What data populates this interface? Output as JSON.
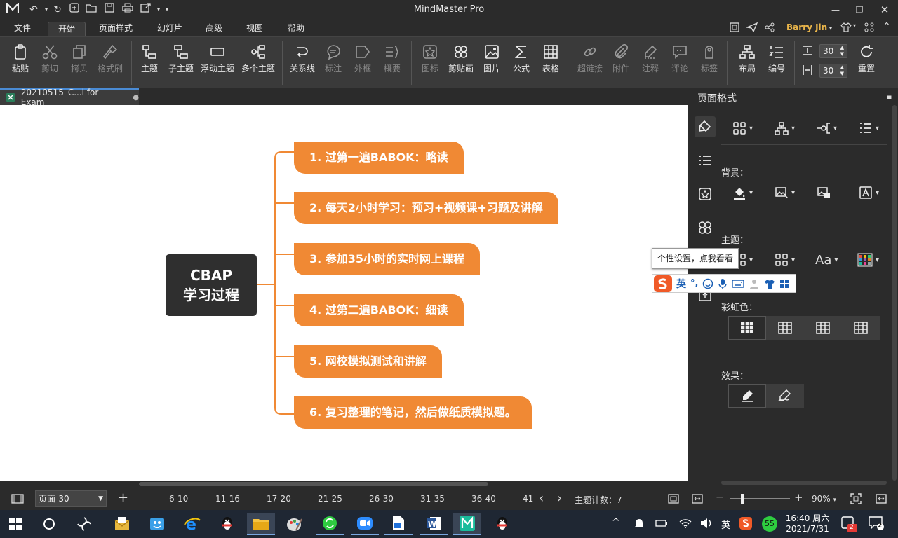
{
  "app": {
    "title": "MindMaster Pro",
    "user": "Barry Jin"
  },
  "menu": [
    "文件",
    "开始",
    "页面样式",
    "幻灯片",
    "高级",
    "视图",
    "帮助"
  ],
  "ribbon": {
    "paste": "粘贴",
    "cut": "剪切",
    "copy": "拷贝",
    "format_painter": "格式刷",
    "topic": "主题",
    "subtopic": "子主题",
    "floating_topic": "浮动主题",
    "multiple_topics": "多个主题",
    "relationship": "关系线",
    "callout": "标注",
    "boundary": "外框",
    "summary": "概要",
    "icon": "图标",
    "clipart": "剪贴画",
    "image": "图片",
    "formula": "公式",
    "table": "表格",
    "hyperlink": "超链接",
    "attachment": "附件",
    "note": "注释",
    "comment": "评论",
    "tag": "标签",
    "layout": "布局",
    "numbering": "编号",
    "spacing_h": "30",
    "spacing_v": "30",
    "reset": "重置"
  },
  "document": {
    "tab_name": "20210515_C...l for Exam"
  },
  "map": {
    "central_line1": "CBAP",
    "central_line2": "学习过程",
    "branches": [
      "1. 过第一遍BABOK：略读",
      "2. 每天2小时学习：预习+视频课+习题及讲解",
      "3. 参加35小时的实时网上课程",
      "4. 过第二遍BABOK：细读",
      "5. 网校模拟测试和讲解",
      "6. 复习整理的笔记，然后做纸质模拟题。"
    ],
    "branch_color": "#f08934",
    "central_color": "#2f2f2f"
  },
  "panel": {
    "title": "页面格式",
    "background_label": "背景：",
    "theme_label": "主题：",
    "rainbow_label": "彩虹色：",
    "effect_label": "效果：",
    "theme_font": "Aa"
  },
  "tooltip": "个性设置，点我看看",
  "ime": {
    "mode": "英"
  },
  "status": {
    "page_select": "页面-30",
    "page_ranges": [
      "6-10",
      "11-16",
      "17-20",
      "21-25",
      "26-30",
      "31-35",
      "36-40",
      "41-"
    ],
    "topic_count": "主题计数：7",
    "zoom": "90%"
  },
  "taskbar": {
    "lang": "英",
    "time": "16:40 周六",
    "date": "2021/7/31",
    "badge_55": "55",
    "notif_badge": "2",
    "msg_badge": "2"
  },
  "colors": {
    "accent": "#4a8bd4",
    "user": "#e8b44a"
  }
}
